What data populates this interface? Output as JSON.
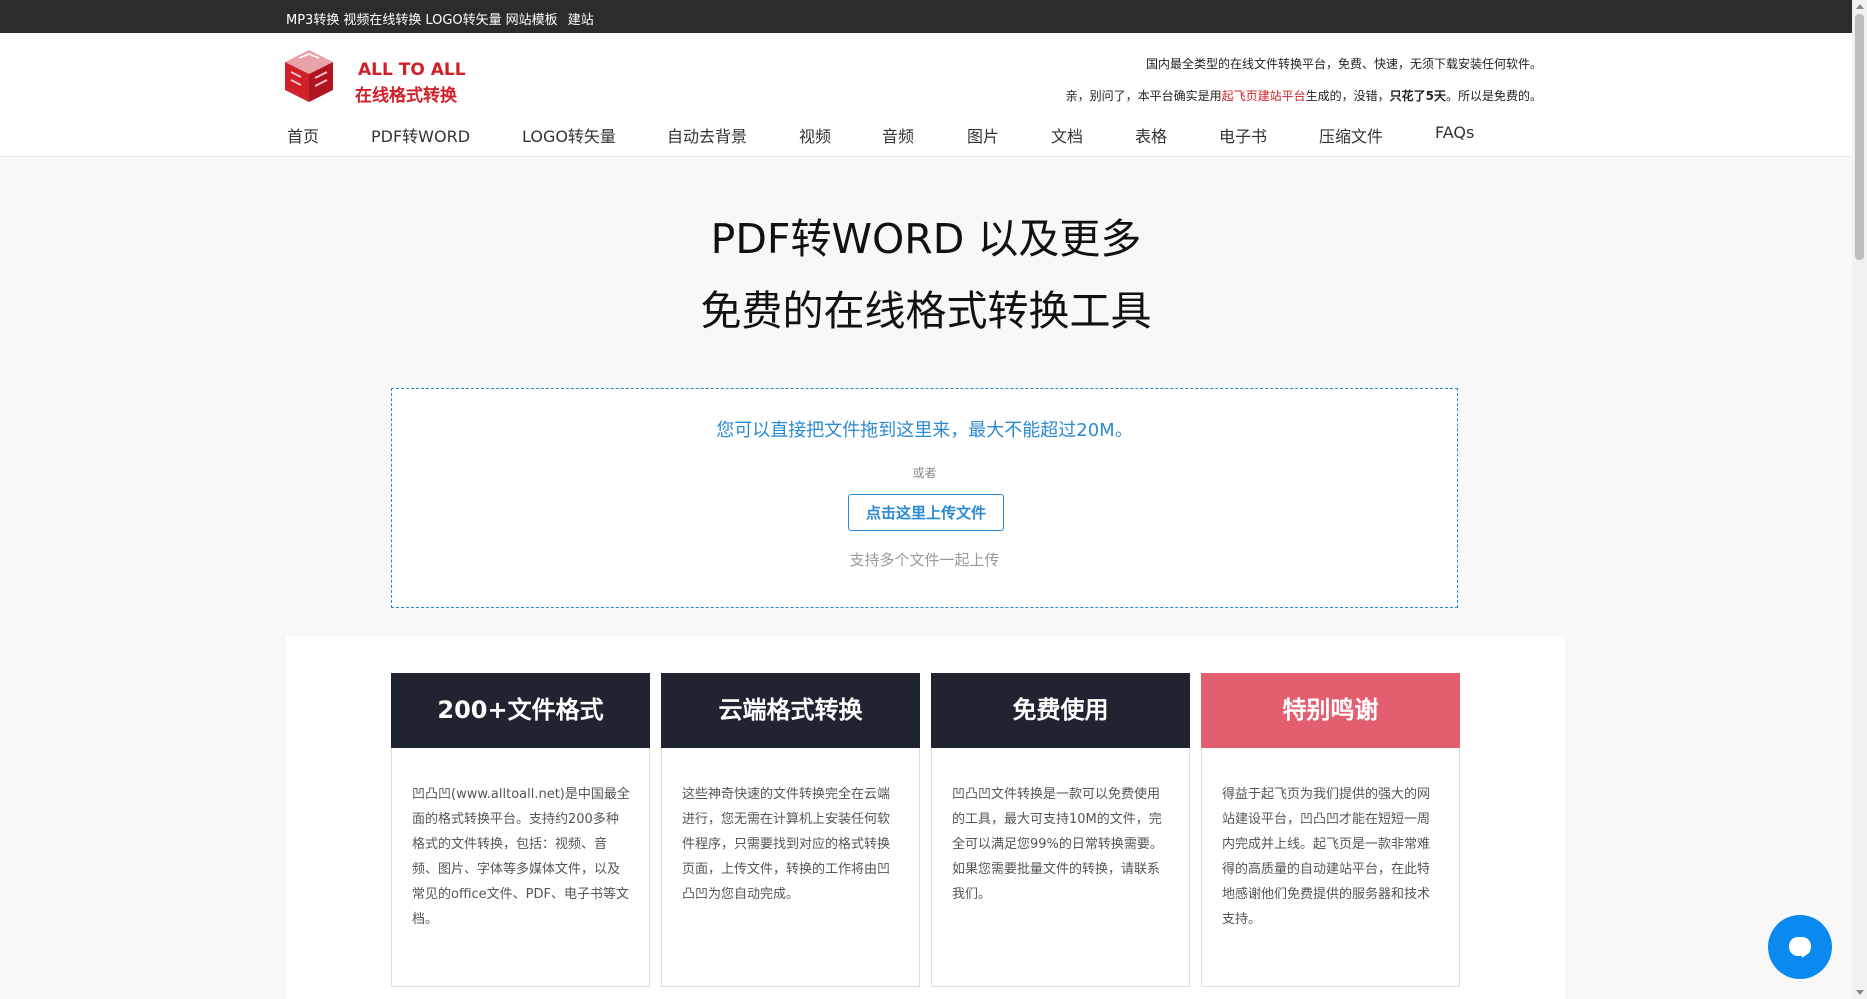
{
  "topbar": {
    "links": [
      "MP3转换",
      "视频在线转换",
      "LOGO转矢量",
      "网站模板",
      "建站"
    ]
  },
  "logo": {
    "line1": "ALL TO ALL",
    "line2": "在线格式转换",
    "icon": "cube-logo-icon",
    "color": "#d0202a"
  },
  "tagline": {
    "line1": "国内最全类型的在线文件转换平台，免费、快速，无须下载安装任何软件。",
    "line2_a": "亲，别问了，本平台确实是用",
    "line2_link": "起飞页建站平台",
    "line2_b": "生成的，没错，",
    "line2_bold": "只花了5天",
    "line2_c": "。所以是免费的。"
  },
  "nav": [
    "首页",
    "PDF转WORD",
    "LOGO转矢量",
    "自动去背景",
    "视频",
    "音频",
    "图片",
    "文档",
    "表格",
    "电子书",
    "压缩文件",
    "FAQs"
  ],
  "hero": {
    "title1": "PDF转WORD 以及更多",
    "title2": "免费的在线格式转换工具"
  },
  "dropzone": {
    "main": "您可以直接把文件拖到这里来，最大不能超过20M。",
    "or": "或者",
    "button": "点击这里上传文件",
    "multi": "支持多个文件一起上传"
  },
  "features": [
    {
      "title": "200+文件格式",
      "body": "凹凸凹(www.alltoall.net)是中国最全面的格式转换平台。支持约200多种格式的文件转换，包括：视频、音频、图片、字体等多媒体文件，以及常见的office文件、PDF、电子书等文档。"
    },
    {
      "title": "云端格式转换",
      "body": "这些神奇快速的文件转换完全在云端进行，您无需在计算机上安装任何软件程序，只需要找到对应的格式转换页面，上传文件，转换的工作将由凹凸凹为您自动完成。"
    },
    {
      "title": "免费使用",
      "body": "凹凸凹文件转换是一款可以免费使用的工具，最大可支持10M的文件，完全可以满足您99%的日常转换需要。如果您需要批量文件的转换，请联系我们。"
    },
    {
      "title": "特别鸣谢",
      "body": "得益于起飞页为我们提供的强大的网站建设平台，凹凸凹才能在短短一周内完成并上线。起飞页是一款非常难得的高质量的自动建站平台，在此特地感谢他们免费提供的服务器和技术支持。"
    }
  ],
  "chat": {
    "icon": "chat-bubble-icon",
    "color": "#0a8af0"
  }
}
